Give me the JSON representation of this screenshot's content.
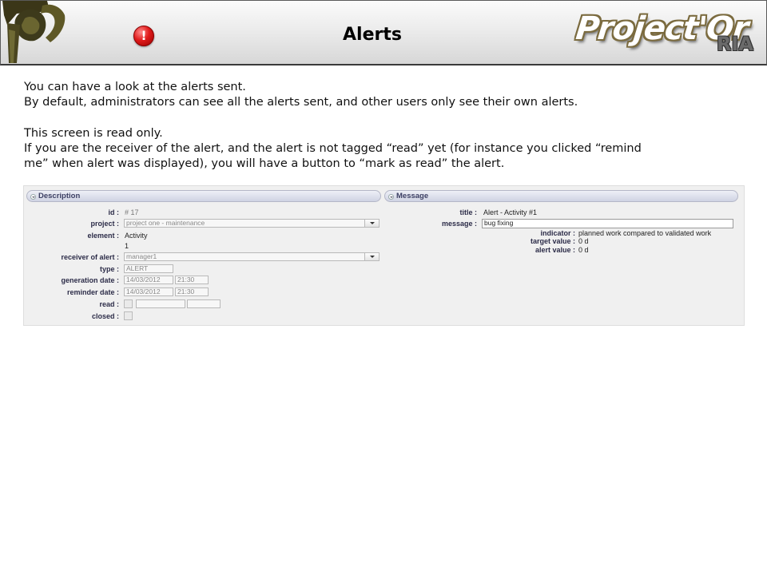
{
  "header": {
    "title": "Alerts",
    "brand_main": "Project'Or",
    "brand_sub": "RIA"
  },
  "intro": {
    "line1": "You can have a look at the alerts sent.",
    "line2": "By default, administrators can see all the alerts sent, and other users only see their own alerts.",
    "line3": "This screen is read only.",
    "line4": "If you are the receiver of the alert, and the alert is not tagged “read” yet (for instance you clicked “remind",
    "line5": "me” when alert was displayed), you will have a button to “mark as read” the alert."
  },
  "description": {
    "section_label": "Description",
    "id_label": "id :",
    "id_value": "# 17",
    "project_label": "project :",
    "project_value": "project one - maintenance",
    "element_label": "element :",
    "element_value": "Activity",
    "element_id": "1",
    "receiver_label": "receiver of alert :",
    "receiver_value": "manager1",
    "type_label": "type :",
    "type_value": "ALERT",
    "generation_label": "generation date :",
    "generation_date": "14/03/2012",
    "generation_time": "21:30",
    "reminder_label": "reminder date :",
    "reminder_date": "14/03/2012",
    "reminder_time": "21:30",
    "read_label": "read :",
    "closed_label": "closed :"
  },
  "message": {
    "section_label": "Message",
    "title_label": "title :",
    "title_value": "Alert - Activity #1",
    "message_label": "message :",
    "message_value": "bug fixing",
    "indicator_label": "indicator :",
    "indicator_value": "planned work compared to validated work",
    "target_label": "target value :",
    "target_value": "0 d",
    "alert_label": "alert value :",
    "alert_value": "0 d"
  }
}
